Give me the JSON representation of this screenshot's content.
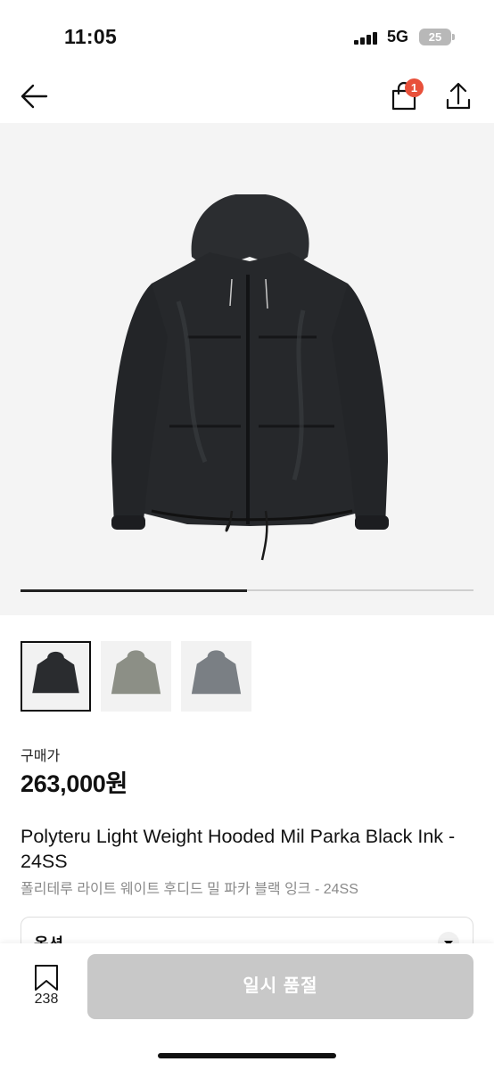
{
  "status": {
    "time": "11:05",
    "network": "5G",
    "battery": "25"
  },
  "nav": {
    "cart_count": "1"
  },
  "gallery": {
    "progress_fraction": 0.5,
    "thumbnail_colors": [
      "black",
      "olive-gray",
      "slate-gray"
    ]
  },
  "product": {
    "price_label": "구매가",
    "price": "263,000원",
    "title_en": "Polyteru Light Weight Hooded Mil Parka Black Ink - 24SS",
    "title_ko": "폴리테루 라이트 웨이트 후디드 밀 파카 블랙 잉크 - 24SS"
  },
  "option": {
    "label": "옵션"
  },
  "bottom": {
    "wish_count": "238",
    "soldout_label": "일시 품절"
  },
  "colors": {
    "badge": "#e8503a",
    "button_disabled": "#c8c8c8",
    "hero_bg": "#f4f4f4"
  },
  "icons": [
    "back-arrow-icon",
    "shopping-bag-icon",
    "share-icon",
    "bookmark-icon",
    "chevron-down-icon"
  ]
}
